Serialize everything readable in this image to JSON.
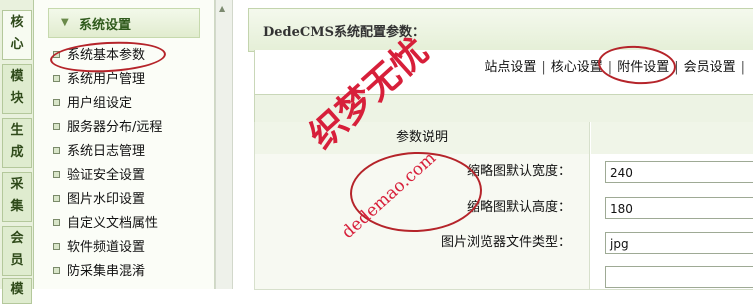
{
  "vertical_tabs": [
    {
      "label": "核心",
      "active": true
    },
    {
      "label": "模块",
      "active": false
    },
    {
      "label": "生成",
      "active": false
    },
    {
      "label": "采集",
      "active": false
    },
    {
      "label": "会员",
      "active": false
    },
    {
      "label": "模",
      "active": false
    }
  ],
  "sidebar": {
    "header": "系统设置",
    "items": [
      {
        "label": "系统基本参数",
        "highlighted": true
      },
      {
        "label": "系统用户管理"
      },
      {
        "label": "用户组设定"
      },
      {
        "label": "服务器分布/远程"
      },
      {
        "label": "系统日志管理"
      },
      {
        "label": "验证安全设置"
      },
      {
        "label": "图片水印设置"
      },
      {
        "label": "自定义文档属性"
      },
      {
        "label": "软件频道设置"
      },
      {
        "label": "防采集串混淆"
      }
    ]
  },
  "main": {
    "title": "DedeCMS系统配置参数：",
    "tabs": [
      "站点设置",
      "核心设置",
      "附件设置",
      "会员设置"
    ],
    "highlighted_tab": "附件设置",
    "table": {
      "header": "参数说明",
      "rows": [
        {
          "label": "缩略图默认宽度：",
          "value": "240"
        },
        {
          "label": "缩略图默认高度：",
          "value": "180"
        },
        {
          "label": "图片浏览器文件类型：",
          "value": "jpg"
        }
      ]
    }
  },
  "watermark": {
    "text": "织梦无忧",
    "domain": "dedemao.com"
  },
  "colors": {
    "annotation": "#b5242a",
    "watermark": "#d71f3a",
    "accent_green": "#2f5a1c"
  }
}
